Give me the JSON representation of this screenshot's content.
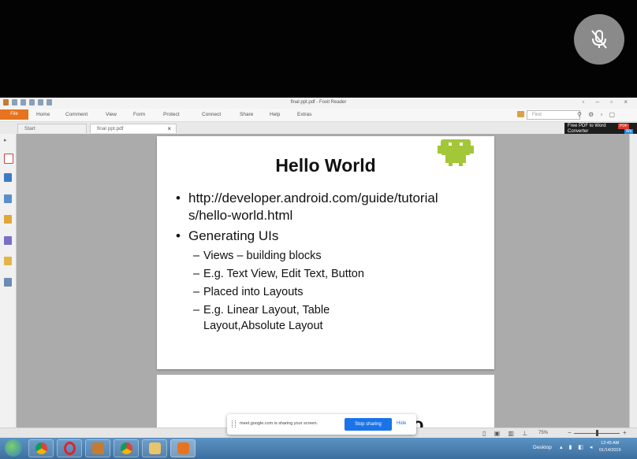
{
  "meet": {
    "mic_icon": "mic-off-icon",
    "share_bar": {
      "message": "meet.google.com is sharing your screen.",
      "stop_label": "Stop sharing",
      "hide_label": "Hide"
    }
  },
  "app": {
    "window_title": "final ppt.pdf - Foxit Reader",
    "menu": [
      "File",
      "Home",
      "Comment",
      "View",
      "Form",
      "Protect",
      "Connect",
      "Share",
      "Help",
      "Extras"
    ],
    "find_placeholder": "Find",
    "tabs": [
      {
        "label": "Start"
      },
      {
        "label": "final ppt.pdf",
        "close": "×"
      }
    ],
    "ad": {
      "line1": "Free PDF to Word",
      "line2": "Converter",
      "badge": "PDF",
      "badge2": "Wo"
    },
    "status": {
      "zoom": "75%"
    }
  },
  "slide": {
    "title": "Hello World",
    "bullets": [
      {
        "dot": "•",
        "text": "http://developer.android.com/guide/tutorial s/hello-world.html"
      },
      {
        "dot": "•",
        "text": "Generating UIs"
      }
    ],
    "subbullets": [
      {
        "dash": "–",
        "text": "Views – building blocks"
      },
      {
        "dash": "–",
        "text": "E.g. Text View, Edit Text, Button"
      },
      {
        "dash": "–",
        "text": "Placed into Layouts"
      },
      {
        "dash": "–",
        "text": "E.g. Linear Layout, Table Layout,Absolute Layout"
      }
    ],
    "next_page_fragment": "lo"
  },
  "taskbar": {
    "apps": [
      "chrome-icon",
      "opera-icon",
      "archive-icon",
      "chrome-icon",
      "folder-icon",
      "foxit-icon"
    ],
    "desktop_label": "Desktop",
    "clock_time": "12:45 AM",
    "clock_date": "01/14/2019"
  },
  "colors": {
    "file_tab": "#e8731e",
    "stop_sharing": "#1a73e8",
    "taskbar": "#4a80b0",
    "android_green": "#a4c639"
  }
}
